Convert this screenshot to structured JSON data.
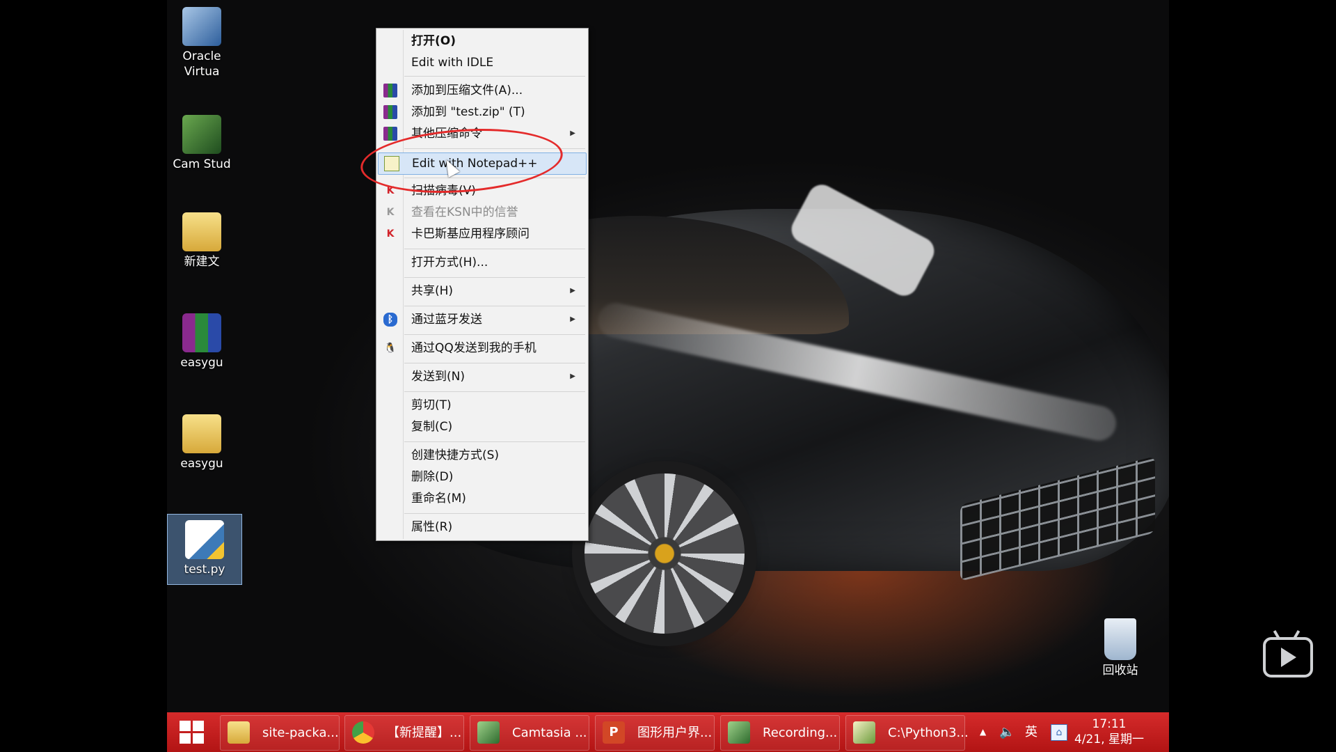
{
  "desktop_icons": [
    {
      "label": "Oracle Virtua",
      "name": "icon-oracle-virtualbox"
    },
    {
      "label": "Cam Stud",
      "name": "icon-camtasia-studio"
    },
    {
      "label": "新建文",
      "name": "icon-new-folder"
    },
    {
      "label": "easygu",
      "name": "icon-easygui-1"
    },
    {
      "label": "easygu",
      "name": "icon-easygui-2"
    },
    {
      "label": "test.py",
      "name": "icon-test-py"
    },
    {
      "label": "回收站",
      "name": "icon-recycle-bin"
    }
  ],
  "context_menu": {
    "items": [
      {
        "label": "打开(O)"
      },
      {
        "label": "Edit with IDLE"
      },
      {
        "label": "添加到压缩文件(A)..."
      },
      {
        "label": "添加到 \"test.zip\" (T)"
      },
      {
        "label": "其他压缩命令"
      },
      {
        "label": "Edit with Notepad++"
      },
      {
        "label": "扫描病毒(V)"
      },
      {
        "label": "查看在KSN中的信誉"
      },
      {
        "label": "卡巴斯基应用程序顾问"
      },
      {
        "label": "打开方式(H)..."
      },
      {
        "label": "共享(H)"
      },
      {
        "label": "通过蓝牙发送"
      },
      {
        "label": "通过QQ发送到我的手机"
      },
      {
        "label": "发送到(N)"
      },
      {
        "label": "剪切(T)"
      },
      {
        "label": "复制(C)"
      },
      {
        "label": "创建快捷方式(S)"
      },
      {
        "label": "删除(D)"
      },
      {
        "label": "重命名(M)"
      },
      {
        "label": "属性(R)"
      }
    ]
  },
  "taskbar": {
    "buttons": [
      {
        "label": "site-packa..."
      },
      {
        "label": "【新提醒】..."
      },
      {
        "label": "Camtasia ..."
      },
      {
        "label": "图形用户界..."
      },
      {
        "label": "Recording..."
      },
      {
        "label": "C:\\Python3..."
      }
    ],
    "ime": "英",
    "clock_time": "17:11",
    "clock_date": "4/21, 星期一"
  },
  "colors": {
    "taskbar": "#c41e1e",
    "menu_highlight": "#d7e6f7",
    "annotation": "#e42b2b"
  }
}
